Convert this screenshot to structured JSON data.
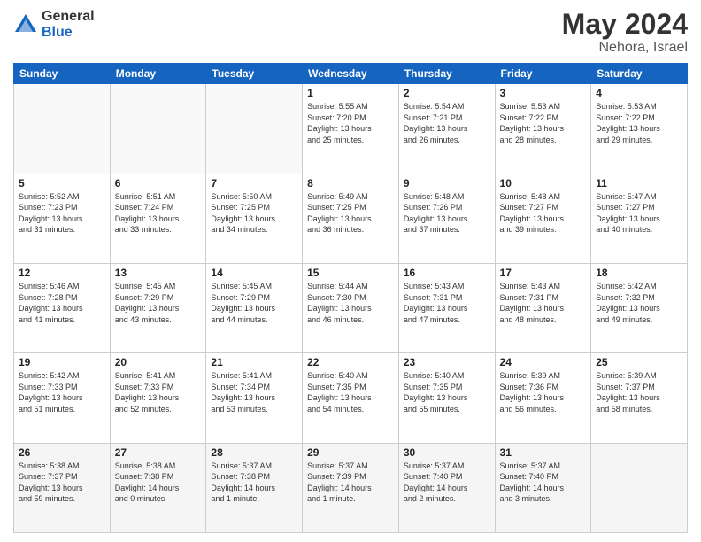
{
  "header": {
    "logo_general": "General",
    "logo_blue": "Blue",
    "month": "May 2024",
    "location": "Nehora, Israel"
  },
  "days_of_week": [
    "Sunday",
    "Monday",
    "Tuesday",
    "Wednesday",
    "Thursday",
    "Friday",
    "Saturday"
  ],
  "weeks": [
    [
      {
        "day": "",
        "info": ""
      },
      {
        "day": "",
        "info": ""
      },
      {
        "day": "",
        "info": ""
      },
      {
        "day": "1",
        "info": "Sunrise: 5:55 AM\nSunset: 7:20 PM\nDaylight: 13 hours\nand 25 minutes."
      },
      {
        "day": "2",
        "info": "Sunrise: 5:54 AM\nSunset: 7:21 PM\nDaylight: 13 hours\nand 26 minutes."
      },
      {
        "day": "3",
        "info": "Sunrise: 5:53 AM\nSunset: 7:22 PM\nDaylight: 13 hours\nand 28 minutes."
      },
      {
        "day": "4",
        "info": "Sunrise: 5:53 AM\nSunset: 7:22 PM\nDaylight: 13 hours\nand 29 minutes."
      }
    ],
    [
      {
        "day": "5",
        "info": "Sunrise: 5:52 AM\nSunset: 7:23 PM\nDaylight: 13 hours\nand 31 minutes."
      },
      {
        "day": "6",
        "info": "Sunrise: 5:51 AM\nSunset: 7:24 PM\nDaylight: 13 hours\nand 33 minutes."
      },
      {
        "day": "7",
        "info": "Sunrise: 5:50 AM\nSunset: 7:25 PM\nDaylight: 13 hours\nand 34 minutes."
      },
      {
        "day": "8",
        "info": "Sunrise: 5:49 AM\nSunset: 7:25 PM\nDaylight: 13 hours\nand 36 minutes."
      },
      {
        "day": "9",
        "info": "Sunrise: 5:48 AM\nSunset: 7:26 PM\nDaylight: 13 hours\nand 37 minutes."
      },
      {
        "day": "10",
        "info": "Sunrise: 5:48 AM\nSunset: 7:27 PM\nDaylight: 13 hours\nand 39 minutes."
      },
      {
        "day": "11",
        "info": "Sunrise: 5:47 AM\nSunset: 7:27 PM\nDaylight: 13 hours\nand 40 minutes."
      }
    ],
    [
      {
        "day": "12",
        "info": "Sunrise: 5:46 AM\nSunset: 7:28 PM\nDaylight: 13 hours\nand 41 minutes."
      },
      {
        "day": "13",
        "info": "Sunrise: 5:45 AM\nSunset: 7:29 PM\nDaylight: 13 hours\nand 43 minutes."
      },
      {
        "day": "14",
        "info": "Sunrise: 5:45 AM\nSunset: 7:29 PM\nDaylight: 13 hours\nand 44 minutes."
      },
      {
        "day": "15",
        "info": "Sunrise: 5:44 AM\nSunset: 7:30 PM\nDaylight: 13 hours\nand 46 minutes."
      },
      {
        "day": "16",
        "info": "Sunrise: 5:43 AM\nSunset: 7:31 PM\nDaylight: 13 hours\nand 47 minutes."
      },
      {
        "day": "17",
        "info": "Sunrise: 5:43 AM\nSunset: 7:31 PM\nDaylight: 13 hours\nand 48 minutes."
      },
      {
        "day": "18",
        "info": "Sunrise: 5:42 AM\nSunset: 7:32 PM\nDaylight: 13 hours\nand 49 minutes."
      }
    ],
    [
      {
        "day": "19",
        "info": "Sunrise: 5:42 AM\nSunset: 7:33 PM\nDaylight: 13 hours\nand 51 minutes."
      },
      {
        "day": "20",
        "info": "Sunrise: 5:41 AM\nSunset: 7:33 PM\nDaylight: 13 hours\nand 52 minutes."
      },
      {
        "day": "21",
        "info": "Sunrise: 5:41 AM\nSunset: 7:34 PM\nDaylight: 13 hours\nand 53 minutes."
      },
      {
        "day": "22",
        "info": "Sunrise: 5:40 AM\nSunset: 7:35 PM\nDaylight: 13 hours\nand 54 minutes."
      },
      {
        "day": "23",
        "info": "Sunrise: 5:40 AM\nSunset: 7:35 PM\nDaylight: 13 hours\nand 55 minutes."
      },
      {
        "day": "24",
        "info": "Sunrise: 5:39 AM\nSunset: 7:36 PM\nDaylight: 13 hours\nand 56 minutes."
      },
      {
        "day": "25",
        "info": "Sunrise: 5:39 AM\nSunset: 7:37 PM\nDaylight: 13 hours\nand 58 minutes."
      }
    ],
    [
      {
        "day": "26",
        "info": "Sunrise: 5:38 AM\nSunset: 7:37 PM\nDaylight: 13 hours\nand 59 minutes."
      },
      {
        "day": "27",
        "info": "Sunrise: 5:38 AM\nSunset: 7:38 PM\nDaylight: 14 hours\nand 0 minutes."
      },
      {
        "day": "28",
        "info": "Sunrise: 5:37 AM\nSunset: 7:38 PM\nDaylight: 14 hours\nand 1 minute."
      },
      {
        "day": "29",
        "info": "Sunrise: 5:37 AM\nSunset: 7:39 PM\nDaylight: 14 hours\nand 1 minute."
      },
      {
        "day": "30",
        "info": "Sunrise: 5:37 AM\nSunset: 7:40 PM\nDaylight: 14 hours\nand 2 minutes."
      },
      {
        "day": "31",
        "info": "Sunrise: 5:37 AM\nSunset: 7:40 PM\nDaylight: 14 hours\nand 3 minutes."
      },
      {
        "day": "",
        "info": ""
      }
    ]
  ]
}
